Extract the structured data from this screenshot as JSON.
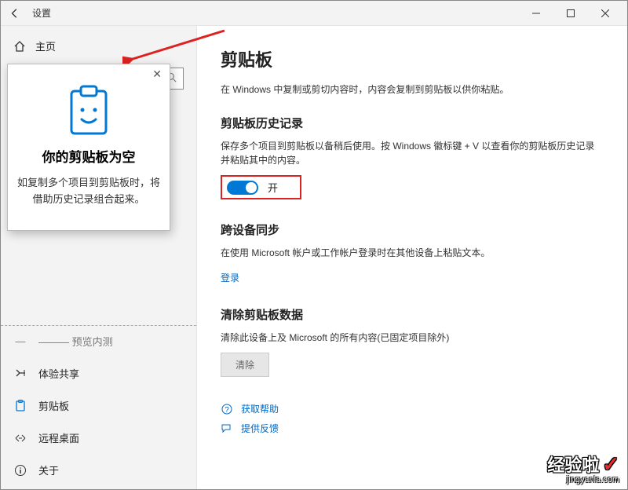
{
  "window": {
    "title": "设置",
    "home_label": "主页",
    "search_placeholder": ""
  },
  "sidebar": {
    "items": [
      {
        "label": "体验共享",
        "icon": "share"
      },
      {
        "label": "剪贴板",
        "icon": "clipboard"
      },
      {
        "label": "远程桌面",
        "icon": "remote"
      },
      {
        "label": "关于",
        "icon": "info"
      }
    ],
    "hidden_item": {
      "label": "———  预览内测"
    }
  },
  "main": {
    "title": "剪贴板",
    "intro": "在 Windows 中复制或剪切内容时，内容会复制到剪贴板以供你粘贴。",
    "history": {
      "title": "剪贴板历史记录",
      "desc": "保存多个项目到剪贴板以备稍后使用。按 Windows 徽标键 + V 以查看你的剪贴板历史记录并粘贴其中的内容。",
      "toggle_label": "开"
    },
    "sync": {
      "title": "跨设备同步",
      "desc": "在使用 Microsoft 帐户或工作帐户登录时在其他设备上粘贴文本。",
      "link": "登录"
    },
    "clear": {
      "title": "清除剪贴板数据",
      "desc": "清除此设备上及 Microsoft 的所有内容(已固定项目除外)",
      "button": "清除"
    },
    "links": [
      {
        "label": "获取帮助",
        "icon": "help"
      },
      {
        "label": "提供反馈",
        "icon": "feedback"
      }
    ]
  },
  "popup": {
    "title": "你的剪贴板为空",
    "desc": "如复制多个项目到剪贴板时，将借助历史记录组合起来。"
  },
  "watermark": {
    "main": "经验啦",
    "sub": "jingyanla.com"
  }
}
